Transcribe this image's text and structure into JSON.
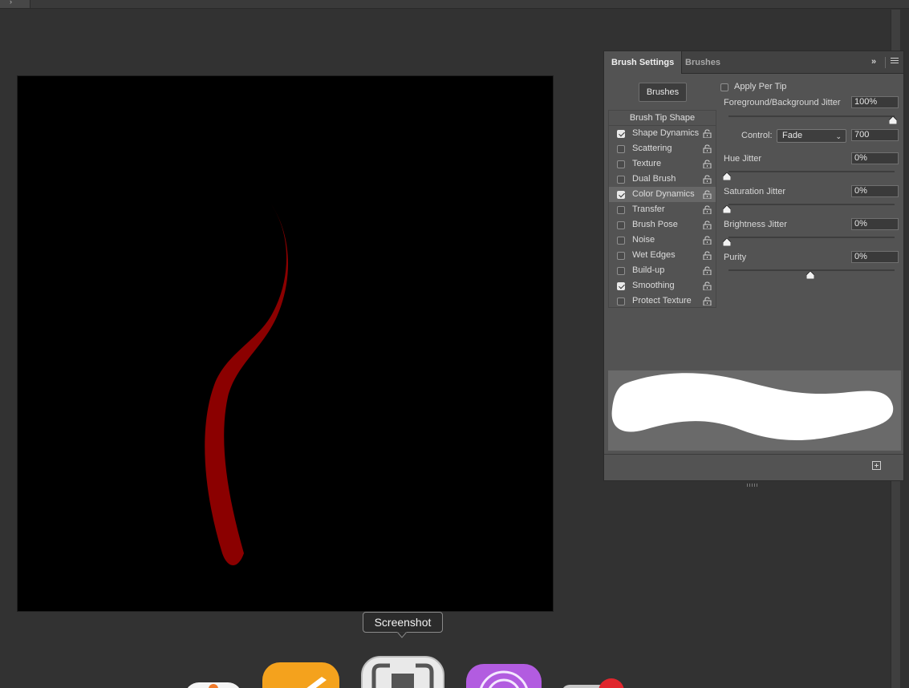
{
  "panel": {
    "tabs": [
      {
        "label": "Brush Settings"
      },
      {
        "label": "Brushes"
      }
    ],
    "brushes_button": "Brushes",
    "list_header": "Brush Tip Shape",
    "items": [
      {
        "label": "Shape Dynamics",
        "checked": true,
        "selected": false
      },
      {
        "label": "Scattering",
        "checked": false,
        "selected": false
      },
      {
        "label": "Texture",
        "checked": false,
        "selected": false
      },
      {
        "label": "Dual Brush",
        "checked": false,
        "selected": false
      },
      {
        "label": "Color Dynamics",
        "checked": true,
        "selected": true
      },
      {
        "label": "Transfer",
        "checked": false,
        "selected": false
      },
      {
        "label": "Brush Pose",
        "checked": false,
        "selected": false
      },
      {
        "label": "Noise",
        "checked": false,
        "selected": false
      },
      {
        "label": "Wet Edges",
        "checked": false,
        "selected": false
      },
      {
        "label": "Build-up",
        "checked": false,
        "selected": false
      },
      {
        "label": "Smoothing",
        "checked": true,
        "selected": false
      },
      {
        "label": "Protect Texture",
        "checked": false,
        "selected": false
      }
    ],
    "apply_per_tip": {
      "label": "Apply Per Tip",
      "checked": false
    },
    "fg_bg_jitter": {
      "label": "Foreground/Background Jitter",
      "value": "100%",
      "level": 1.0
    },
    "control": {
      "label": "Control:",
      "selected": "Fade",
      "value": "700"
    },
    "hue_jitter": {
      "label": "Hue Jitter",
      "value": "0%",
      "level": 0.0
    },
    "saturation_jitter": {
      "label": "Saturation Jitter",
      "value": "0%",
      "level": 0.0
    },
    "brightness_jitter": {
      "label": "Brightness Jitter",
      "value": "0%",
      "level": 0.0
    },
    "purity": {
      "label": "Purity",
      "value": "0%",
      "level": 0.5
    }
  },
  "tooltip": {
    "text": "Screenshot"
  },
  "colors": {
    "stroke": "#8b0000",
    "canvas": "#000000",
    "panel_bg": "#535353",
    "app_bg": "#323232"
  }
}
